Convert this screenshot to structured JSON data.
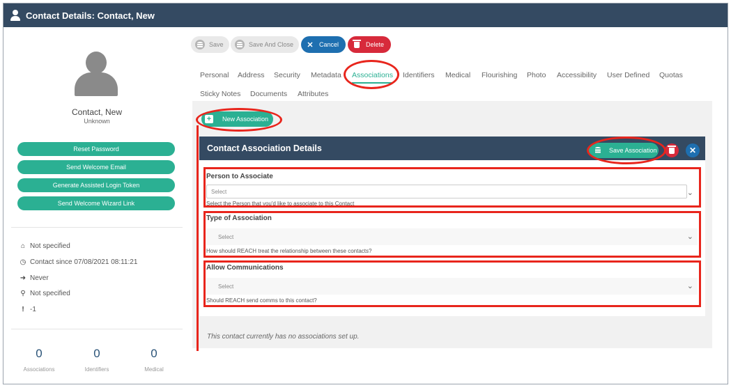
{
  "window": {
    "title": "Contact Details: Contact, New"
  },
  "profile": {
    "name": "Contact, New",
    "subtitle": "Unknown"
  },
  "actions": [
    "Reset Password",
    "Send Welcome Email",
    "Generate Assisted Login Token",
    "Send Welcome Wizard Link"
  ],
  "info": {
    "item1": "Not specified",
    "contact_since": "Contact since 07/08/2021 08:11:21",
    "last_login": "Never",
    "item4": "Not specified",
    "item5": "-1"
  },
  "stats": [
    {
      "value": "0",
      "label": "Associations"
    },
    {
      "value": "0",
      "label": "Identifiers"
    },
    {
      "value": "0",
      "label": "Medical"
    }
  ],
  "toolbar": {
    "save": "Save",
    "save_close": "Save And Close",
    "cancel": "Cancel",
    "delete": "Delete"
  },
  "tabs": [
    "Personal",
    "Address",
    "Security",
    "Metadata",
    "Associations",
    "Identifiers",
    "Medical",
    "Flourishing",
    "Photo",
    "Accessibility",
    "User Defined",
    "Quotas",
    "Sticky Notes",
    "Documents",
    "Attributes"
  ],
  "active_tab": "Associations",
  "new_association": "New Association",
  "panel": {
    "title": "Contact Association Details",
    "save_label": "Save Association",
    "fields": [
      {
        "label": "Person to Associate",
        "placeholder": "Select",
        "help": "Select the Person that you'd like to associate to this Contact"
      },
      {
        "label": "Type of Association",
        "placeholder": "Select",
        "help": "How should REACH treat the relationship between these contacts?"
      },
      {
        "label": "Allow Communications",
        "placeholder": "Select",
        "help": "Should REACH send comms to this contact?"
      }
    ]
  },
  "empty_message": "This contact currently has no associations set up.",
  "colors": {
    "header": "#344a62",
    "accent": "#2bb093",
    "primary": "#1e6fb0",
    "danger": "#d72a3b",
    "annotation": "#e8251c"
  }
}
